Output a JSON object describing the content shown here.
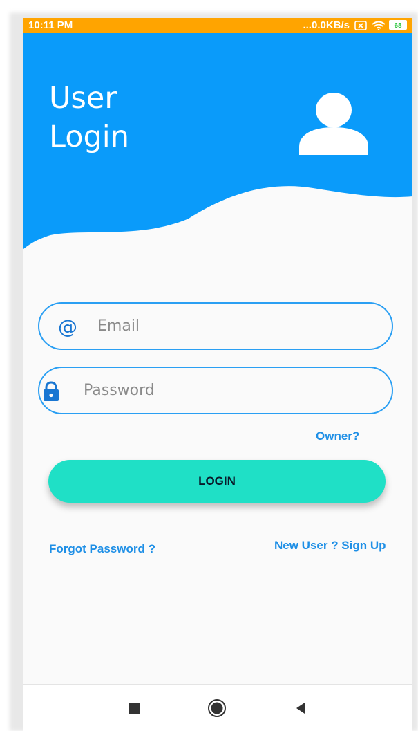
{
  "status_bar": {
    "time": "10:11 PM",
    "network_speed": "...0.0KB/s",
    "battery_level": "68",
    "icons": [
      "sim-icon",
      "wifi-icon",
      "battery-icon"
    ],
    "color": "#ffa400"
  },
  "header": {
    "title_line1": "User",
    "title_line2": "Login",
    "icon": "user-avatar-icon",
    "color": "#0a9bfa"
  },
  "form": {
    "email": {
      "icon": "at-icon",
      "icon_glyph": "@",
      "placeholder": "Email",
      "value": ""
    },
    "password": {
      "icon": "lock-icon",
      "placeholder": "Password",
      "value": ""
    },
    "owner_link": "Owner?",
    "login_button": "LOGIN",
    "forgot_password_link": "Forgot Password ?",
    "signup_link": "New User ? Sign Up"
  },
  "nav_bar": {
    "buttons": [
      "recent-apps-icon",
      "home-icon",
      "back-icon"
    ]
  },
  "colors": {
    "accent_blue": "#1e8fe6",
    "field_border": "#2a9ff3",
    "login_button": "#1fe0c6",
    "background": "#fafafa"
  }
}
